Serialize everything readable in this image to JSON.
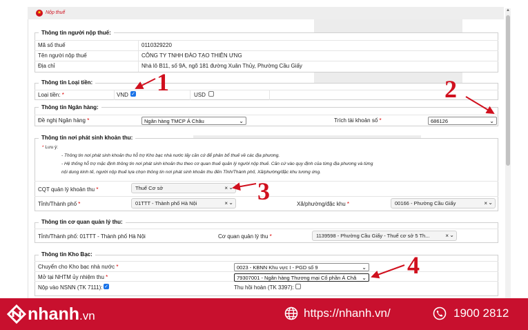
{
  "colors": {
    "accent": "#d0101e",
    "brand_red": "#c8102e",
    "check_blue": "#1a73e8"
  },
  "header": {
    "title": "Nộp thuế",
    "icon": "emblem-icon"
  },
  "taxpayer": {
    "section_title": "Thông tin người nộp thuế:",
    "rows": [
      {
        "label": "Mã số thuế",
        "value": "0110329220"
      },
      {
        "label": "Tên người nộp thuế",
        "value": "CÔNG TY TNHH ĐÀO TẠO THIÊN ƯNG"
      },
      {
        "label": "Địa chỉ",
        "value": "Nhà lô B11, số 9A, ngõ 181 đường Xuân Thủy, Phường Cầu Giấy"
      }
    ]
  },
  "currency": {
    "section_title": "Thông tin Loại tiền:",
    "label": "Loại tiền:",
    "req": "*",
    "vnd_label": "VND",
    "vnd_checked": true,
    "usd_label": "USD",
    "usd_checked": false
  },
  "bank": {
    "section_title": "Thông tin Ngân hàng:",
    "bank_label": "Đề nghị Ngân hàng",
    "bank_value": "Ngân hàng TMCP Á Châu",
    "account_label": "Trích tài khoản số",
    "account_value": "686126",
    "req": "*"
  },
  "revenue": {
    "section_title": "Thông tin nơi phát sinh khoản thu:",
    "note_title": "Lưu ý:",
    "note_lines": [
      "- Thông tin nơi phát sinh khoản thu hỗ trợ Kho bạc nhà nước lấy căn cứ để phân bổ thuế về các địa phương.",
      "- Hệ thống hỗ trợ mặc định thông tin nơi phát sinh khoản thu theo cơ quan thuế quản lý người nộp thuế. Căn cứ vào quy định của từng địa phương và từng",
      "nội dung kinh tế, người nộp thuế lựa chọn thông tin nơi phát sinh khoản thu đến Tỉnh/Thành phố, Xã/phường/đặc khu tương ứng."
    ],
    "cqt_label": "CQT quản lý khoản thu",
    "cqt_value": "Thuế Cơ sở",
    "province_label": "Tỉnh/Thành phố",
    "province_value": "01TTT - Thành phố Hà Nội",
    "ward_label": "Xã/phường/đặc khu",
    "ward_value": "00166 - Phường Cầu Giấy",
    "req": "*",
    "clear_glyph": "×",
    "arrow_glyph": "⌄"
  },
  "agency": {
    "section_title": "Thông tin cơ quan quản lý thu:",
    "province_text": "Tỉnh/Thành phố: 01TTT - Thành phố Hà Nội",
    "agency_label": "Cơ quan quản lý thu",
    "agency_value": "1139598 - Phường Cầu Giấy - Thuế cơ sở 5 Th...",
    "req": "*"
  },
  "treasury": {
    "section_title": "Thông tin Kho Bạc:",
    "transfer_label": "Chuyển cho Kho bạc nhà nước",
    "transfer_value": "0023 - KBNN Khu vực I - PGD số 9",
    "nhtm_label": "Mở tại NHTM ủy nhiệm thu",
    "nhtm_value": "79307001 - Ngân hàng Thương mại Cổ phần Á Châ",
    "nsnn_label": "Nộp vào NSNN (TK 7111):",
    "nsnn_checked": true,
    "refund_label": "Thu hồi hoàn (TK 3397):",
    "refund_checked": false,
    "req": "*"
  },
  "annotations": [
    "1",
    "2",
    "3",
    "4"
  ],
  "footer": {
    "brand": "nhanh",
    "brand_suffix": ".vn",
    "url": "https://nhanh.vn/",
    "phone": "1900 2812"
  }
}
